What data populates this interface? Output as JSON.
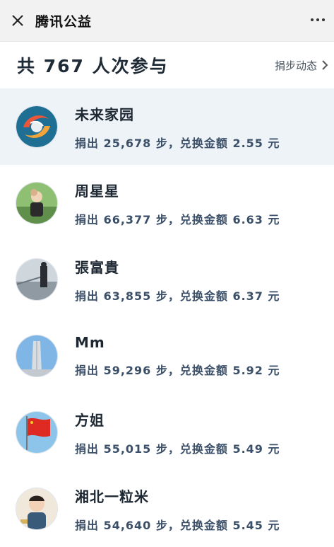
{
  "header": {
    "title": "腾讯公益"
  },
  "summary": {
    "participants_text": "共 767 人次参与",
    "link_label": "捐步动态"
  },
  "donors": [
    {
      "name": "未来家园",
      "detail": "捐出 25,678 步，兑换金额 2.55 元"
    },
    {
      "name": "周星星",
      "detail": "捐出 66,377 步，兑换金额 6.63 元"
    },
    {
      "name": "張富貴",
      "detail": "捐出 63,855 步，兑换金额 6.37 元"
    },
    {
      "name": "Mm",
      "detail": "捐出 59,296 步，兑换金额 5.92 元"
    },
    {
      "name": "方姐",
      "detail": "捐出 55,015 步，兑换金额 5.49 元"
    },
    {
      "name": "湘北一粒米",
      "detail": "捐出 54,640 步，兑换金额 5.45 元"
    }
  ],
  "icons": {
    "close": "close-icon",
    "more": "more-icon",
    "chevron": "chevron-right-icon"
  }
}
